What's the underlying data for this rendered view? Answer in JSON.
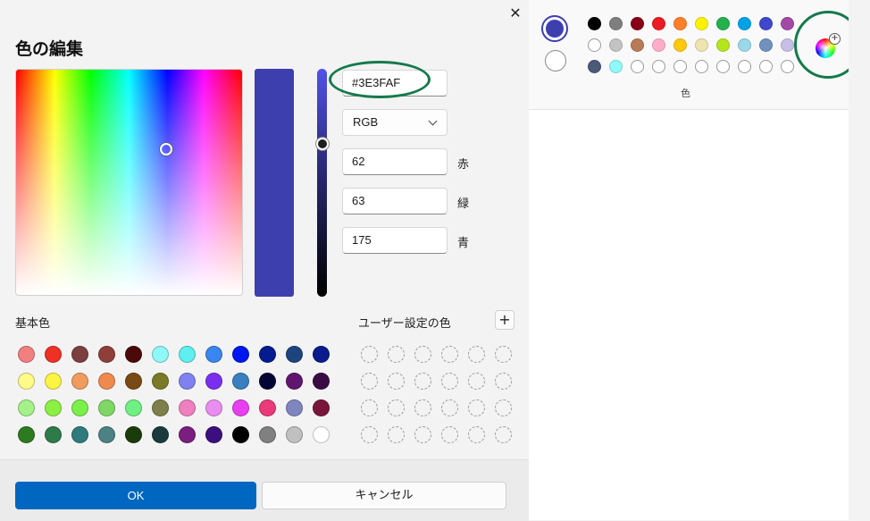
{
  "dialog": {
    "title": "色の編集",
    "close_icon": "close-icon",
    "current_color": "#3E3FAF",
    "hex_value": "#3E3FAF",
    "mode": "RGB",
    "red_value": "62",
    "green_value": "63",
    "blue_value": "175",
    "red_label": "赤",
    "green_label": "緑",
    "blue_label": "青",
    "basic_colors_label": "基本色",
    "custom_colors_label": "ユーザー設定の色",
    "add_custom_icon": "plus-icon",
    "ok_label": "OK",
    "cancel_label": "キャンセル",
    "basic_colors": [
      "#f08080",
      "#ee3124",
      "#7b3f3f",
      "#8e3f3a",
      "#4a0a0a",
      "#8ff8f8",
      "#5ef0f0",
      "#3a86f0",
      "#0016f0",
      "#051b91",
      "#1e4480",
      "#0b1b8c",
      "#fffb88",
      "#fbf444",
      "#f09c5e",
      "#ef8a4f",
      "#7a4a14",
      "#7a7a26",
      "#8081f0",
      "#7a2ff0",
      "#3a7fbf",
      "#050535",
      "#60166e",
      "#3b0c44",
      "#a6f08a",
      "#8cf044",
      "#7af04a",
      "#7fd766",
      "#6ef082",
      "#7f7f4b",
      "#ef7fbf",
      "#e98ef0",
      "#e840f0",
      "#ea3a7a",
      "#7f86bf",
      "#7a153a",
      "#2e7a20",
      "#2f7a49",
      "#2f7a7a",
      "#4d8284",
      "#1b3b0b",
      "#1a3b3e",
      "#7a1e7f",
      "#3b0f7f",
      "#000000",
      "#808080",
      "#c0c0c0",
      "#ffffff"
    ]
  },
  "paint_palette": {
    "label": "色",
    "primary_color": "#3e3faf",
    "secondary_color": "#ffffff",
    "rows": [
      [
        "#000000",
        "#7f7f7f",
        "#880015",
        "#ed1c24",
        "#ff7f27",
        "#fff200",
        "#22b14c",
        "#00a2e8",
        "#3f48cc",
        "#a349a4"
      ],
      [
        "#ffffff",
        "#c3c3c3",
        "#b97a57",
        "#ffaec9",
        "#ffc90e",
        "#efe4b0",
        "#b5e61d",
        "#99d9ea",
        "#7092be",
        "#c8bfe7"
      ],
      [
        "#4a5a78",
        "#8ff8f8",
        "#ffffff",
        "#ffffff",
        "#ffffff",
        "#ffffff",
        "#ffffff",
        "#ffffff",
        "#ffffff",
        "#ffffff"
      ]
    ],
    "edit_colors_icon": "color-wheel-icon"
  }
}
